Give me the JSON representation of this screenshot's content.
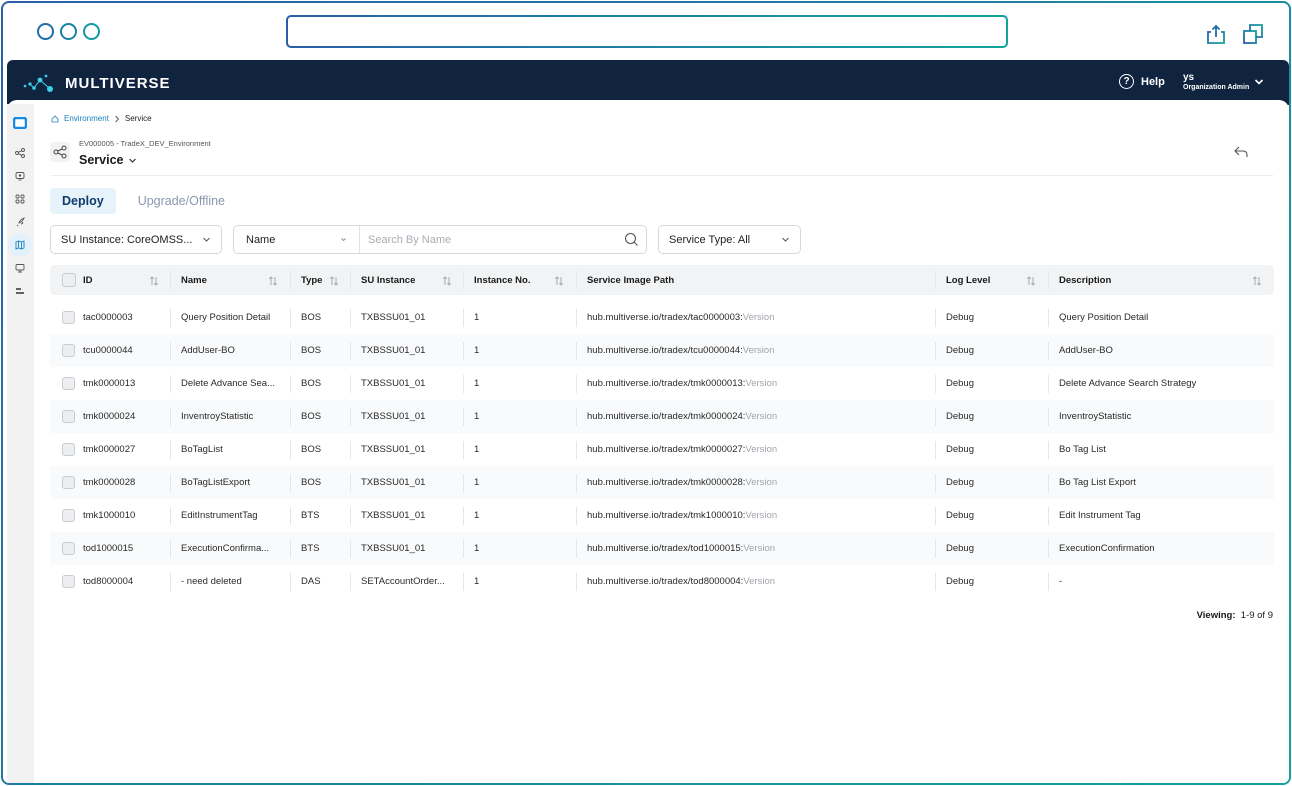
{
  "browser": {
    "url": "",
    "icons": [
      "share-icon",
      "new-window-icon"
    ]
  },
  "header": {
    "logo_text": "MULTIVERSE",
    "help_label": "Help",
    "user_name": "ys",
    "user_role": "Organization Admin"
  },
  "sidebar": {
    "items": [
      {
        "icon": "dashboard-icon",
        "active": true
      },
      {
        "icon": "share-nodes-icon",
        "active": false
      },
      {
        "icon": "monitor-eye-icon",
        "active": false
      },
      {
        "icon": "grid-icon",
        "active": false
      },
      {
        "icon": "rocket-icon",
        "active": false
      },
      {
        "icon": "map-icon",
        "active": true
      },
      {
        "icon": "display-icon",
        "active": false
      },
      {
        "icon": "sliders-icon",
        "active": false
      }
    ]
  },
  "breadcrumb": {
    "home": "Environment",
    "current": "Service"
  },
  "page": {
    "environment_label": "EV000005 - TradeX_DEV_Environment",
    "title": "Service"
  },
  "tabs": [
    {
      "label": "Deploy",
      "active": true
    },
    {
      "label": "Upgrade/Offline",
      "active": false
    }
  ],
  "filters": {
    "su_instance": "SU Instance: CoreOMSS...",
    "search_field": "Name",
    "search_placeholder": "Search By Name",
    "search_value": "",
    "service_type": "Service Type: All"
  },
  "table": {
    "columns": [
      "ID",
      "Name",
      "Type",
      "SU Instance",
      "Instance No.",
      "Service Image Path",
      "Log Level",
      "Description"
    ],
    "version_suffix": "Version",
    "rows": [
      {
        "id": "tac0000003",
        "name": "Query Position Detail",
        "type": "BOS",
        "su_instance": "TXBSSU01_01",
        "instance_no": "1",
        "image_path": "hub.multiverse.io/tradex/tac0000003:",
        "log_level": "Debug",
        "description": "Query Position Detail"
      },
      {
        "id": "tcu0000044",
        "name": "AddUser-BO",
        "type": "BOS",
        "su_instance": "TXBSSU01_01",
        "instance_no": "1",
        "image_path": "hub.multiverse.io/tradex/tcu0000044:",
        "log_level": "Debug",
        "description": "AddUser-BO"
      },
      {
        "id": "tmk0000013",
        "name": "Delete Advance Sea...",
        "type": "BOS",
        "su_instance": "TXBSSU01_01",
        "instance_no": "1",
        "image_path": "hub.multiverse.io/tradex/tmk0000013:",
        "log_level": "Debug",
        "description": "Delete Advance Search Strategy"
      },
      {
        "id": "tmk0000024",
        "name": "InventroyStatistic",
        "type": "BOS",
        "su_instance": "TXBSSU01_01",
        "instance_no": "1",
        "image_path": "hub.multiverse.io/tradex/tmk0000024:",
        "log_level": "Debug",
        "description": "InventroyStatistic"
      },
      {
        "id": "tmk0000027",
        "name": "BoTagList",
        "type": "BOS",
        "su_instance": "TXBSSU01_01",
        "instance_no": "1",
        "image_path": "hub.multiverse.io/tradex/tmk0000027:",
        "log_level": "Debug",
        "description": "Bo Tag List"
      },
      {
        "id": "tmk0000028",
        "name": "BoTagListExport",
        "type": "BOS",
        "su_instance": "TXBSSU01_01",
        "instance_no": "1",
        "image_path": "hub.multiverse.io/tradex/tmk0000028:",
        "log_level": "Debug",
        "description": "Bo Tag List Export"
      },
      {
        "id": "tmk1000010",
        "name": "EditInstrumentTag",
        "type": "BTS",
        "su_instance": "TXBSSU01_01",
        "instance_no": "1",
        "image_path": "hub.multiverse.io/tradex/tmk1000010:",
        "log_level": "Debug",
        "description": "Edit Instrument Tag"
      },
      {
        "id": "tod1000015",
        "name": "ExecutionConfirma...",
        "type": "BTS",
        "su_instance": "TXBSSU01_01",
        "instance_no": "1",
        "image_path": "hub.multiverse.io/tradex/tod1000015:",
        "log_level": "Debug",
        "description": "ExecutionConfirmation"
      },
      {
        "id": "tod8000004",
        "name": "- need deleted",
        "type": "DAS",
        "su_instance": "SETAccountOrder...",
        "instance_no": "1",
        "image_path": "hub.multiverse.io/tradex/tod8000004:",
        "log_level": "Debug",
        "description": "-"
      }
    ]
  },
  "pagination": {
    "label": "Viewing:",
    "range": "1-9 of 9"
  },
  "colors": {
    "header_bg": "#10233f",
    "accent": "#1c7fbd",
    "tab_active_bg": "#e6f3fb",
    "frame_gradient_start": "#2a5ea8",
    "frame_gradient_end": "#13a39a"
  }
}
